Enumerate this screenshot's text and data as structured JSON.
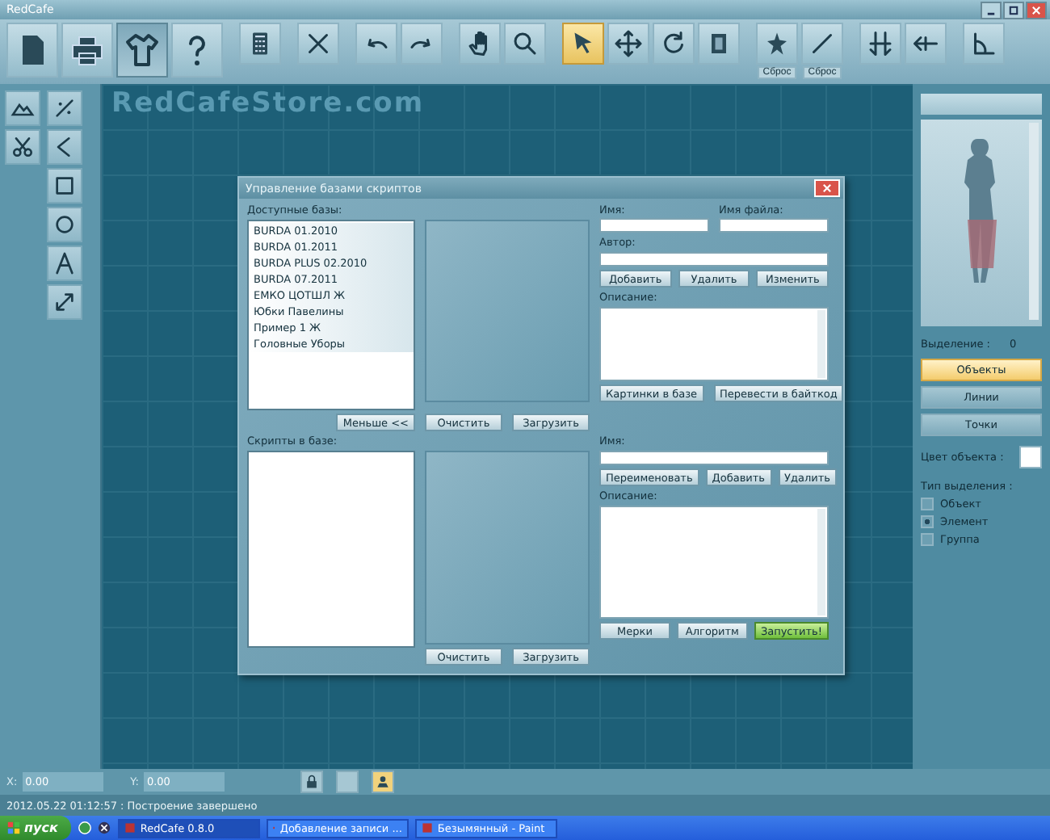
{
  "window": {
    "title": "RedCafe"
  },
  "toolbar": [
    {
      "selected": false
    },
    {
      "selected": false
    },
    {
      "selected": true
    },
    {
      "selected": false
    },
    {
      "selected": false
    },
    {
      "selected": false
    },
    {
      "selected": false
    },
    {
      "selected": false
    },
    {
      "selected": false
    },
    {
      "selected": false
    },
    {
      "selected": true
    },
    {
      "selected": false
    },
    {
      "selected": false
    },
    {
      "selected": false
    },
    {
      "selected": false,
      "caption": "Сброс"
    },
    {
      "selected": false,
      "caption": "Сброс"
    },
    {
      "selected": false
    },
    {
      "selected": false
    },
    {
      "selected": false
    }
  ],
  "canvas": {
    "watermark": "RedCafeStore.com"
  },
  "dialog": {
    "title": "Управление базами скриптов",
    "bases": {
      "label": "Доступные базы:",
      "items": [
        "BURDA 01.2010",
        "BURDA 01.2011",
        "BURDA PLUS 02.2010",
        "BURDA 07.2011",
        "ЕМКО ЦОТШЛ Ж",
        "Юбки Павелины",
        "Пример 1 Ж",
        "Головные Уборы"
      ],
      "preview_buttons": [
        "Очистить",
        "Загрузить"
      ],
      "name_label": "Имя:",
      "filename_label": "Имя файла:",
      "author_label": "Автор:",
      "buttons": [
        "Добавить",
        "Удалить",
        "Изменить"
      ],
      "description_label": "Описание:",
      "bottom_buttons": [
        "Картинки в базе",
        "Перевести в байткод"
      ]
    },
    "less_button": "Меньше <<",
    "scripts": {
      "label": "Скрипты в базе:",
      "preview_buttons": [
        "Очистить",
        "Загрузить"
      ],
      "name_label": "Имя:",
      "buttons": [
        "Переименовать",
        "Добавить",
        "Удалить"
      ],
      "description_label": "Описание:",
      "bottom_buttons": [
        {
          "label": "Мерки",
          "kind": "normal"
        },
        {
          "label": "Алгоритм",
          "kind": "normal"
        },
        {
          "label": "Запустить!",
          "kind": "primary"
        }
      ]
    }
  },
  "right_panel": {
    "selection_label": "Выделение :",
    "selection_count": "0",
    "modes": [
      {
        "label": "Объекты",
        "selected": true
      },
      {
        "label": "Линии",
        "selected": false
      },
      {
        "label": "Точки",
        "selected": false
      }
    ],
    "color_label": "Цвет объекта :",
    "selection_type_label": "Тип выделения :",
    "selection_types": [
      {
        "label": "Объект",
        "checked": false
      },
      {
        "label": "Элемент",
        "checked": true
      },
      {
        "label": "Группа",
        "checked": false
      }
    ]
  },
  "coords": [
    {
      "label": "X:",
      "value": "0.00"
    },
    {
      "label": "Y:",
      "value": "0.00"
    }
  ],
  "bottom_tools": [
    {
      "selected": false
    },
    {
      "selected": false
    },
    {
      "selected": true
    }
  ],
  "status": "2012.05.22 01:12:57 : Построение завершено",
  "taskbar": {
    "start": "пуск",
    "tasks": [
      {
        "label": "RedCafe 0.8.0",
        "selected": true
      },
      {
        "label": "Добавление записи ...",
        "selected": false
      },
      {
        "label": "Безымянный - Paint",
        "selected": false
      }
    ]
  }
}
